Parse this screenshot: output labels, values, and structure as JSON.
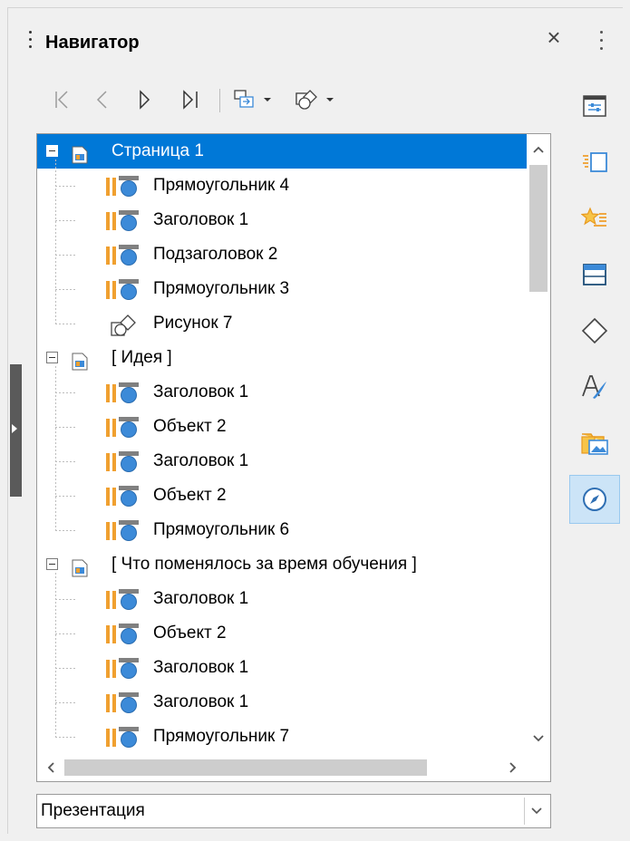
{
  "panel": {
    "title": "Навигатор",
    "close_glyph": "×"
  },
  "toolbar": {
    "buttons": [
      {
        "name": "first-slide",
        "icon": "first-icon"
      },
      {
        "name": "previous-slide",
        "icon": "previous-icon"
      },
      {
        "name": "next-slide",
        "icon": "next-icon"
      },
      {
        "name": "last-slide",
        "icon": "last-icon"
      },
      {
        "name": "drag-mode",
        "icon": "drag-mode-icon"
      },
      {
        "name": "shapes",
        "icon": "shapes-icon"
      }
    ]
  },
  "tree": {
    "items": [
      {
        "type": "page",
        "label": "Страница 1",
        "selected": true
      },
      {
        "type": "shape",
        "label": "Прямоугольник 4"
      },
      {
        "type": "shape",
        "label": "Заголовок 1"
      },
      {
        "type": "shape",
        "label": "Подзаголовок 2"
      },
      {
        "type": "shape",
        "label": "Прямоугольник 3"
      },
      {
        "type": "drawing",
        "label": "Рисунок 7"
      },
      {
        "type": "page",
        "label": "[ Идея ]"
      },
      {
        "type": "shape",
        "label": "Заголовок 1"
      },
      {
        "type": "shape",
        "label": "Объект 2"
      },
      {
        "type": "shape",
        "label": "Заголовок 1"
      },
      {
        "type": "shape",
        "label": "Объект 2"
      },
      {
        "type": "shape",
        "label": "Прямоугольник 6"
      },
      {
        "type": "page",
        "label": "[ Что поменялось за время обучения ]"
      },
      {
        "type": "shape",
        "label": "Заголовок 1"
      },
      {
        "type": "shape",
        "label": "Объект 2"
      },
      {
        "type": "shape",
        "label": "Заголовок 1"
      },
      {
        "type": "shape",
        "label": "Заголовок 1"
      },
      {
        "type": "shape",
        "label": "Прямоугольник 7"
      }
    ]
  },
  "document_select": {
    "value": "Презентация"
  },
  "sidebar_deck": [
    {
      "name": "properties",
      "icon": "properties-icon",
      "active": false
    },
    {
      "name": "slide-transition",
      "icon": "slide-transition-icon",
      "active": false
    },
    {
      "name": "animation",
      "icon": "animation-icon",
      "active": false
    },
    {
      "name": "master-slides",
      "icon": "master-slides-icon",
      "active": false
    },
    {
      "name": "shapes",
      "icon": "shapes-icon",
      "active": false
    },
    {
      "name": "styles",
      "icon": "styles-icon",
      "active": false
    },
    {
      "name": "gallery",
      "icon": "gallery-icon",
      "active": false
    },
    {
      "name": "navigator",
      "icon": "navigator-icon",
      "active": true
    }
  ],
  "colors": {
    "selection": "#0078d7",
    "icon_orange": "#f0a030",
    "icon_blue": "#3c8ad8",
    "active_tab": "#cce4f7"
  }
}
